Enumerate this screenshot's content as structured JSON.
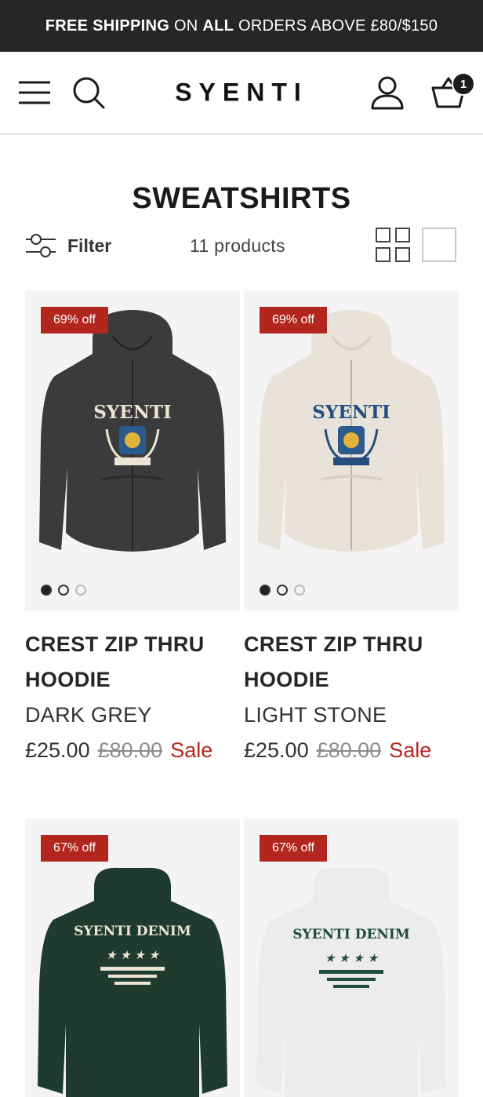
{
  "announcement": {
    "part1": "FREE SHIPPING",
    "part2": " ON ",
    "part3": "ALL",
    "part4": " ORDERS ABOVE £80/$150"
  },
  "header": {
    "logo": "SYENTI",
    "cart_count": "1"
  },
  "collection": {
    "title": "SWEATSHIRTS",
    "filter_label": "Filter",
    "product_count": "11 products"
  },
  "products": [
    {
      "badge": "69% off",
      "title": "CREST ZIP THRU HOODIE",
      "color": "DARK GREY",
      "price": "£25.00",
      "compare_price": "£80.00",
      "sale_label": "Sale",
      "garment_color": "#3b3b3b",
      "print_text": "SYENTI"
    },
    {
      "badge": "69% off",
      "title": "CREST ZIP THRU HOODIE",
      "color": "LIGHT STONE",
      "price": "£25.00",
      "compare_price": "£80.00",
      "sale_label": "Sale",
      "garment_color": "#e9e2d8",
      "print_text": "SYENTI"
    },
    {
      "badge": "67% off",
      "garment_color": "#1f3a2e",
      "print_text": "SYENTI DENIM"
    },
    {
      "badge": "67% off",
      "garment_color": "#ececec",
      "print_text": "SYENTI DENIM"
    }
  ],
  "colors": {
    "sale_red": "#b3261e",
    "announcement_bg": "#262626"
  }
}
